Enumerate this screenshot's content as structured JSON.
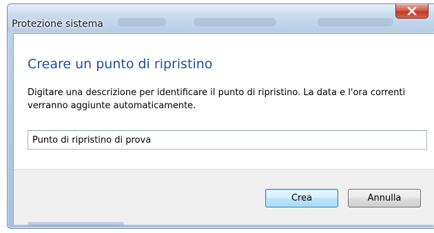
{
  "window": {
    "title": "Protezione sistema",
    "close_icon": "close-icon"
  },
  "dialog": {
    "heading": "Creare un punto di ripristino",
    "description": "Digitare una descrizione per identificare il punto di ripristino. La data e l'ora correnti verranno aggiunte automaticamente.",
    "input_value": "Punto di ripristino di prova"
  },
  "buttons": {
    "create_label": "Crea",
    "cancel_label": "Annulla"
  },
  "colors": {
    "heading": "#1e4f9c",
    "close_button": "#c0392b",
    "footer": "#f0f0f0"
  }
}
